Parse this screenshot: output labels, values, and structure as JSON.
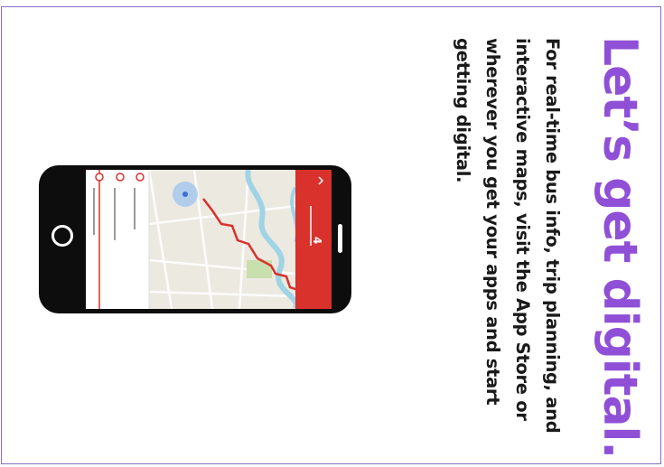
{
  "headline": "Let’s get digital.",
  "body": "For real-time bus info, trip planning, and interactive maps, visit the App Store or wherever you get your apps and start getting digital.",
  "colors": {
    "headline": "#8f4fd6",
    "border": "#8b6cc8",
    "app_header": "#d9312b",
    "route": "#d9312b",
    "water": "#9fd3e6",
    "phone": "#0d0d0d"
  },
  "phone": {
    "app_header_number": "4"
  }
}
